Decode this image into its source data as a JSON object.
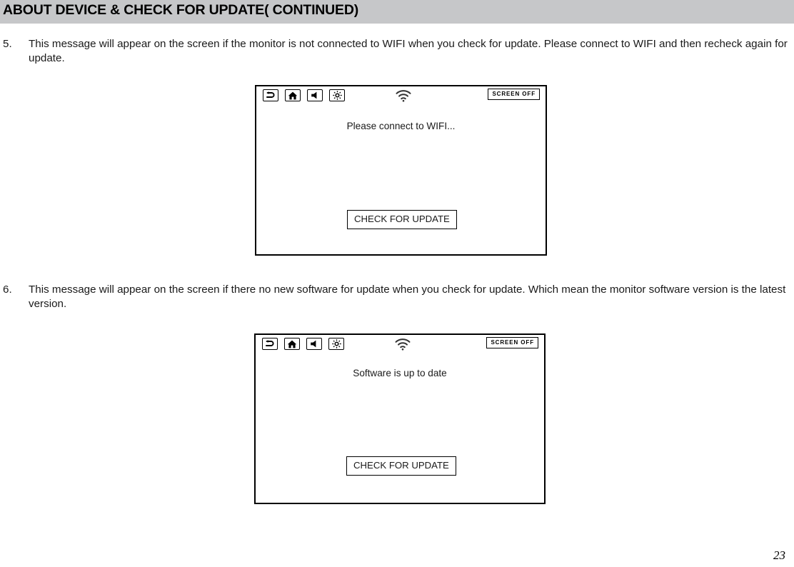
{
  "header": {
    "title": "ABOUT DEVICE & CHECK FOR UPDATE( CONTINUED)",
    "background_color": "#c6c7c9"
  },
  "items": [
    {
      "number": "5.",
      "text": "This message will appear on the screen if the monitor is not connected to WIFI when you check for update. Please connect to WIFI and then recheck again for update."
    },
    {
      "number": "6.",
      "text": "This message will appear on the screen if there no new software for update when you check for update. Which mean the monitor software version is the latest version."
    }
  ],
  "screens": [
    {
      "status_bar": {
        "back_label": "back-icon",
        "home_label": "home-icon",
        "volume_label": "speaker-icon",
        "brightness_label": "brightness-icon",
        "wifi_label": "wifi-icon",
        "screen_off_label": "SCREEN OFF"
      },
      "message": "Please connect to WIFI...",
      "button_label": "CHECK FOR UPDATE"
    },
    {
      "status_bar": {
        "back_label": "back-icon",
        "home_label": "home-icon",
        "volume_label": "speaker-icon",
        "brightness_label": "brightness-icon",
        "wifi_label": "wifi-icon",
        "screen_off_label": "SCREEN OFF"
      },
      "message": "Software is up to date",
      "button_label": "CHECK FOR UPDATE"
    }
  ],
  "footer": {
    "page_number": "23"
  }
}
